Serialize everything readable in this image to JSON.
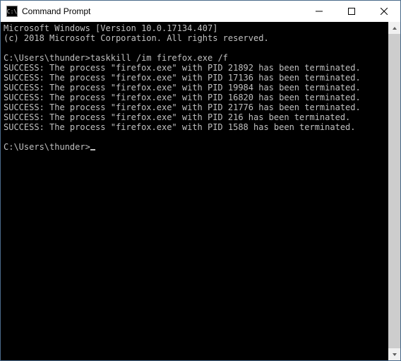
{
  "window": {
    "title": "Command Prompt",
    "icon_name": "cmd-icon"
  },
  "terminal": {
    "line_version": "Microsoft Windows [Version 10.0.17134.407]",
    "line_copyright": "(c) 2018 Microsoft Corporation. All rights reserved.",
    "blank": "",
    "prompt1_prefix": "C:\\Users\\thunder>",
    "prompt1_command": "taskkill /im firefox.exe /f",
    "results": [
      "SUCCESS: The process \"firefox.exe\" with PID 21892 has been terminated.",
      "SUCCESS: The process \"firefox.exe\" with PID 17136 has been terminated.",
      "SUCCESS: The process \"firefox.exe\" with PID 19984 has been terminated.",
      "SUCCESS: The process \"firefox.exe\" with PID 16820 has been terminated.",
      "SUCCESS: The process \"firefox.exe\" with PID 21776 has been terminated.",
      "SUCCESS: The process \"firefox.exe\" with PID 216 has been terminated.",
      "SUCCESS: The process \"firefox.exe\" with PID 1588 has been terminated."
    ],
    "prompt2_prefix": "C:\\Users\\thunder>"
  }
}
